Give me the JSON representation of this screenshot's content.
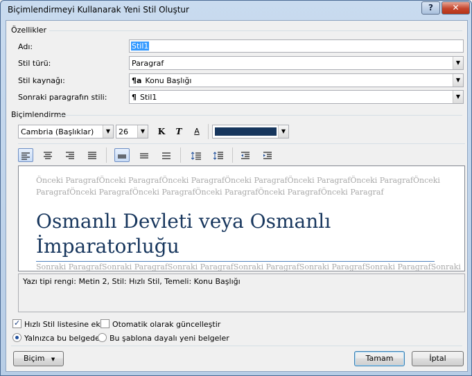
{
  "window": {
    "title": "Biçimlendirmeyi Kullanarak Yeni Stil Oluştur",
    "help_label": "?",
    "close_label": "✕"
  },
  "properties": {
    "heading": "Özellikler",
    "name_label": "Adı:",
    "name_value": "Stil1",
    "style_type_label": "Stil türü:",
    "style_type_value": "Paragraf",
    "based_on_label": "Stil kaynağı:",
    "based_on_glyph": "¶a",
    "based_on_value": "Konu Başlığı",
    "next_style_label": "Sonraki paragrafın stili:",
    "next_style_glyph": "¶",
    "next_style_value": "Stil1"
  },
  "formatting": {
    "heading": "Biçimlendirme",
    "font_value": "Cambria (Başlıklar)",
    "size_value": "26",
    "bold_label": "K",
    "italic_label": "T",
    "underline_label": "A",
    "font_color": "#17365d"
  },
  "preview": {
    "previous_text": "Önceki ParagrafÖnceki ParagrafÖnceki ParagrafÖnceki ParagrafÖnceki ParagrafÖnceki ParagrafÖnceki ParagrafÖnceki ParagrafÖnceki ParagrafÖnceki Paragraf",
    "previous_text_line1": "Önceki ParagrafÖnceki ParagrafÖnceki ParagrafÖnceki ParagrafÖnceki ParagrafÖnceki ParagrafÖnceki",
    "previous_text_line2": "ParagrafÖnceki ParagrafÖnceki ParagrafÖnceki ParagrafÖnceki ParagrafÖnceki Paragraf",
    "sample_line1": "Osmanlı Devleti veya Osmanlı",
    "sample_line2": "İmparatorluğu",
    "next_text": "Sonraki ParagrafSonraki ParagrafSonraki ParagrafSonraki ParagrafSonraki ParagrafSonraki ParagrafSonraki"
  },
  "description": "Yazı tipi rengi: Metin 2, Stil: Hızlı Stil, Temeli: Konu Başlığı",
  "options": {
    "add_quick_style_label": "Hızlı Stil listesine ekle",
    "auto_update_label": "Otomatik olarak güncelleştir",
    "only_this_doc_label": "Yalnızca bu belgede",
    "new_docs_label": "Bu şablona dayalı yeni belgeler"
  },
  "buttons": {
    "format_label": "Biçim",
    "ok_label": "Tamam",
    "cancel_label": "İptal"
  }
}
